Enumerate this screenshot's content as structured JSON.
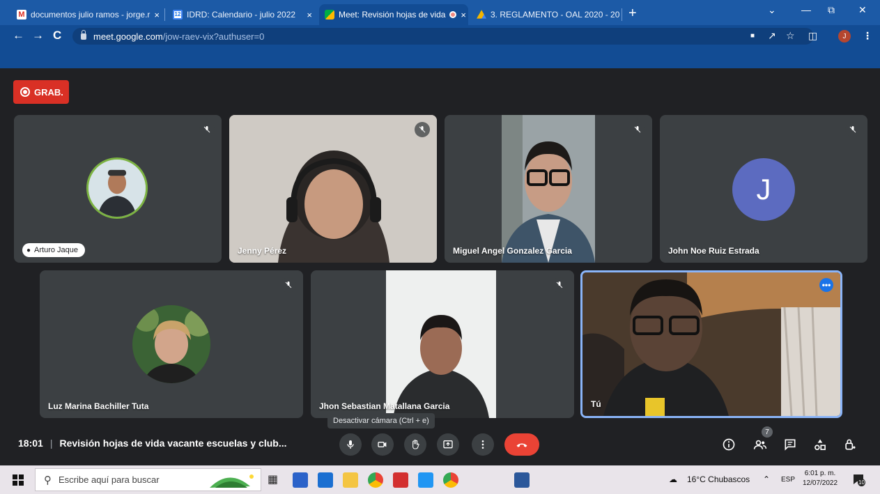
{
  "browser": {
    "tabs": [
      {
        "title": "documentos julio ramos - jorge.r",
        "active": false
      },
      {
        "title": "IDRD: Calendario - julio 2022",
        "active": false
      },
      {
        "title": "Meet: Revisión hojas de vida",
        "active": true
      },
      {
        "title": "3. REGLAMENTO - OAL 2020 - 20",
        "active": false
      }
    ],
    "tab_close": "×",
    "new_tab": "+",
    "url_host": "meet.google.com",
    "url_path": "/jow-raev-vix?authuser=0",
    "profile_initial": "J"
  },
  "meet": {
    "recording_label": "GRAB.",
    "participants": [
      {
        "name": "Arturo Jaque",
        "muted": true
      },
      {
        "name": "Jenny Pérez",
        "muted": true
      },
      {
        "name": "Miguel Angel Gonzalez Garcia",
        "muted": true
      },
      {
        "name": "John Noe Ruiz Estrada",
        "muted": true,
        "avatar_letter": "J"
      },
      {
        "name": "Luz Marina Bachiller Tuta",
        "muted": true
      },
      {
        "name": "Jhon Sebastian Matallana Garcia",
        "muted": true
      },
      {
        "name": "Tú",
        "muted": false
      }
    ],
    "self_more": "•••",
    "tooltip": "Desactivar cámara (Ctrl + e)",
    "time": "18:01",
    "separator": "|",
    "meeting_title": "Revisión hojas de vida vacante escuelas y club...",
    "people_count": "7"
  },
  "taskbar": {
    "search_placeholder": "Escribe aquí para buscar",
    "weather": "16°C  Chubascos",
    "language": "ESP",
    "time": "6:01 p. m.",
    "date": "12/07/2022",
    "notifications": "10"
  },
  "colors": {
    "chrome_blue": "#1c5aa6",
    "meet_bg": "#202124",
    "tile_bg": "#3c4043",
    "end_call": "#ea4335",
    "record_red": "#d93025",
    "self_border": "#8ab4f8"
  }
}
